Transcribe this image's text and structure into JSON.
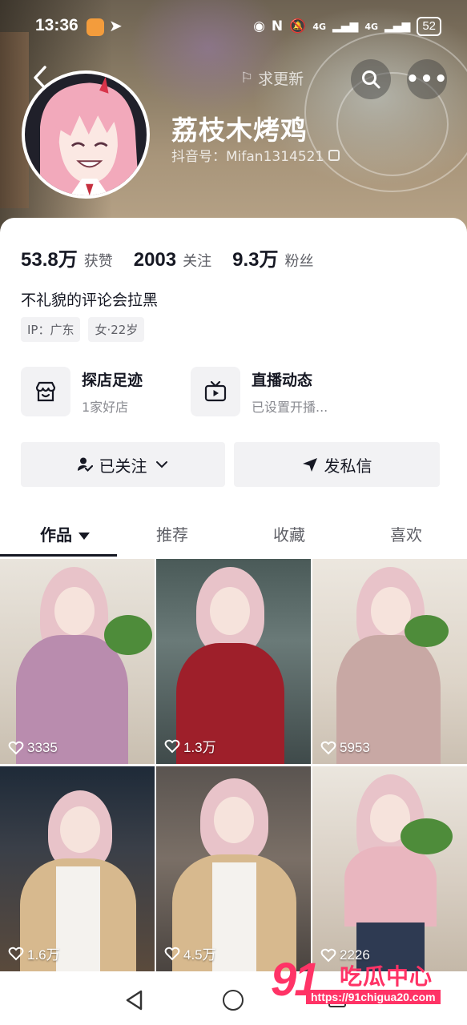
{
  "status_bar": {
    "time": "13:36",
    "network_1": "4G",
    "network_2": "4G",
    "battery": "52"
  },
  "nav": {
    "update_label": "求更新"
  },
  "profile": {
    "nickname": "荔枝木烤鸡",
    "douyin_id": "抖音号：Mifan1314521"
  },
  "stats": [
    {
      "value": "53.8万",
      "label": "获赞"
    },
    {
      "value": "2003",
      "label": "关注"
    },
    {
      "value": "9.3万",
      "label": "粉丝"
    }
  ],
  "bio": "不礼貌的评论会拉黑",
  "tags": [
    "IP：广东",
    "女·22岁"
  ],
  "features": [
    {
      "title": "探店足迹",
      "subtitle": "1家好店",
      "icon": "shop-icon"
    },
    {
      "title": "直播动态",
      "subtitle": "已设置开播...",
      "icon": "tv-icon"
    }
  ],
  "actions": {
    "follow_label": "已关注",
    "message_label": "发私信"
  },
  "tabs": [
    {
      "label": "作品",
      "active": true
    },
    {
      "label": "推荐",
      "active": false
    },
    {
      "label": "收藏",
      "active": false
    },
    {
      "label": "喜欢",
      "active": false
    }
  ],
  "videos": [
    {
      "likes": "3335"
    },
    {
      "likes": "1.3万"
    },
    {
      "likes": "5953"
    },
    {
      "likes": "1.6万"
    },
    {
      "likes": "4.5万"
    },
    {
      "likes": "2226"
    }
  ],
  "watermark": {
    "number": "91",
    "text": "吃瓜中心",
    "url": "https://91chigua20.com"
  },
  "colors": {
    "accent": "#ff3366",
    "text_primary": "#161823",
    "text_secondary": "#5e5f66",
    "chip_bg": "#f2f2f4"
  }
}
